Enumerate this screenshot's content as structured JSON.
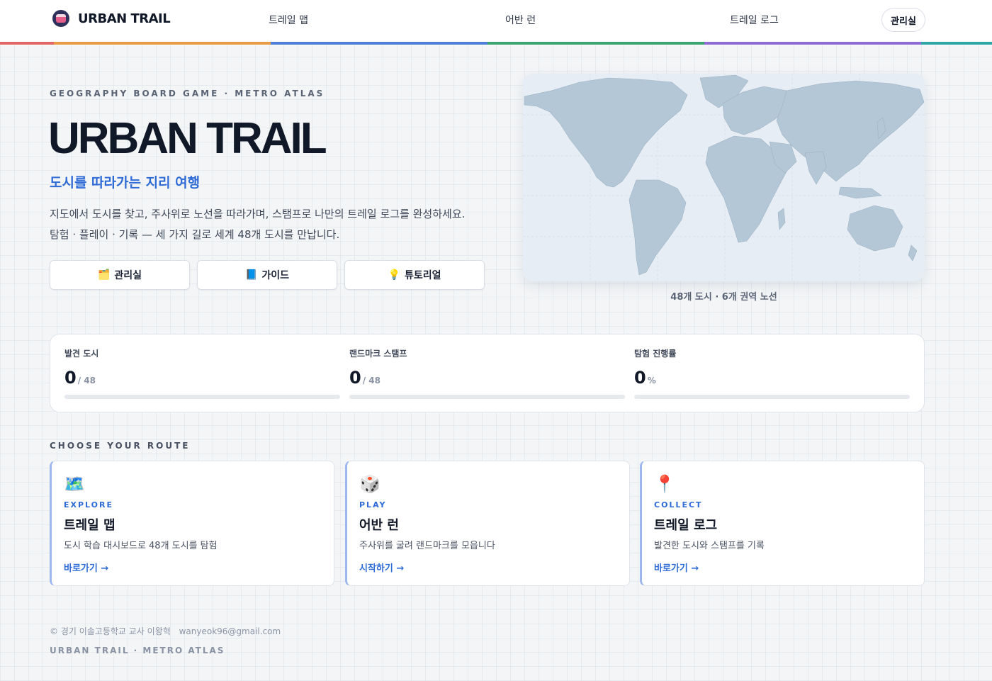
{
  "header": {
    "brand": "URBAN TRAIL",
    "nav": [
      "트레일 맵",
      "어반 런",
      "트레일 로그"
    ],
    "admin": "관리실",
    "stripe_colors": [
      "#e06666",
      "#e99a45",
      "#4f7fd8",
      "#3aa56e",
      "#8f6bd6",
      "#2fa6a6"
    ]
  },
  "hero": {
    "eyebrow": "GEOGRAPHY BOARD GAME · METRO ATLAS",
    "title": "URBAN TRAIL",
    "subtitle": "도시를 따라가는 지리 여행",
    "desc1": "지도에서 도시를 찾고, 주사위로 노선을 따라가며, 스탬프로 나만의 트레일 로그를 완성하세요.",
    "desc2": "탐험 · 플레이 · 기록 — 세 가지 길로 세계 48개 도시를 만납니다.",
    "buttons": [
      {
        "icon": "🗂️",
        "label": "관리실"
      },
      {
        "icon": "📘",
        "label": "가이드"
      },
      {
        "icon": "💡",
        "label": "튜토리얼"
      }
    ]
  },
  "map": {
    "caption": "48개 도시 · 6개 권역 노선",
    "land_color": "#b4c7d6"
  },
  "stats": [
    {
      "label": "발견 도시",
      "value": "0",
      "unit": "/ 48",
      "progress": 0
    },
    {
      "label": "랜드마크 스탬프",
      "value": "0",
      "unit": "/ 48",
      "progress": 0
    },
    {
      "label": "탐험 진행률",
      "value": "0",
      "unit": "%",
      "progress": 0
    }
  ],
  "routes": {
    "section_label": "CHOOSE YOUR ROUTE",
    "cards": [
      {
        "icon": "🗺️",
        "tag": "EXPLORE",
        "title": "트레일 맵",
        "desc": "도시 학습 대시보드로 48개 도시를 탐험",
        "link": "바로가기 →"
      },
      {
        "icon": "🎲",
        "tag": "PLAY",
        "title": "어반 런",
        "desc": "주사위를 굴려 랜드마크를 모읍니다",
        "link": "시작하기 →"
      },
      {
        "icon": "📍",
        "tag": "COLLECT",
        "title": "트레일 로그",
        "desc": "발견한 도시와 스탬프를 기록",
        "link": "바로가기 →"
      }
    ]
  },
  "footer": {
    "credit": "© 경기 이솔고등학교 교사 이왕혁",
    "email": "wanyeok96@gmail.com",
    "tagline": "URBAN TRAIL · METRO ATLAS"
  }
}
